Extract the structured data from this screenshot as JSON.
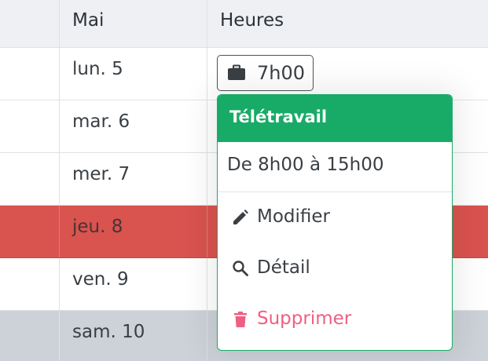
{
  "table": {
    "headers": [
      "",
      "Mai",
      "Heures"
    ],
    "rows": [
      {
        "day": "lun. 5"
      },
      {
        "day": "mar. 6"
      },
      {
        "day": "mer. 7"
      },
      {
        "day": "jeu. 8"
      },
      {
        "day": "ven. 9"
      },
      {
        "day": "sam. 10"
      }
    ]
  },
  "hours_button": {
    "icon": "briefcase-icon",
    "label": "7h00"
  },
  "popover": {
    "title": "Télétravail",
    "time_range": "De 8h00 à 15h00",
    "menu": [
      {
        "icon": "pencil-icon",
        "label": "Modifier"
      },
      {
        "icon": "magnifier-icon",
        "label": "Détail"
      },
      {
        "icon": "trash-icon",
        "label": "Supprimer"
      }
    ]
  },
  "colors": {
    "header_bg": "#eef0f4",
    "highlight_row": "#d9534f",
    "weekend_row": "#cdd1d8",
    "popover_accent": "#18ab67",
    "danger_text": "#ef5f82"
  }
}
